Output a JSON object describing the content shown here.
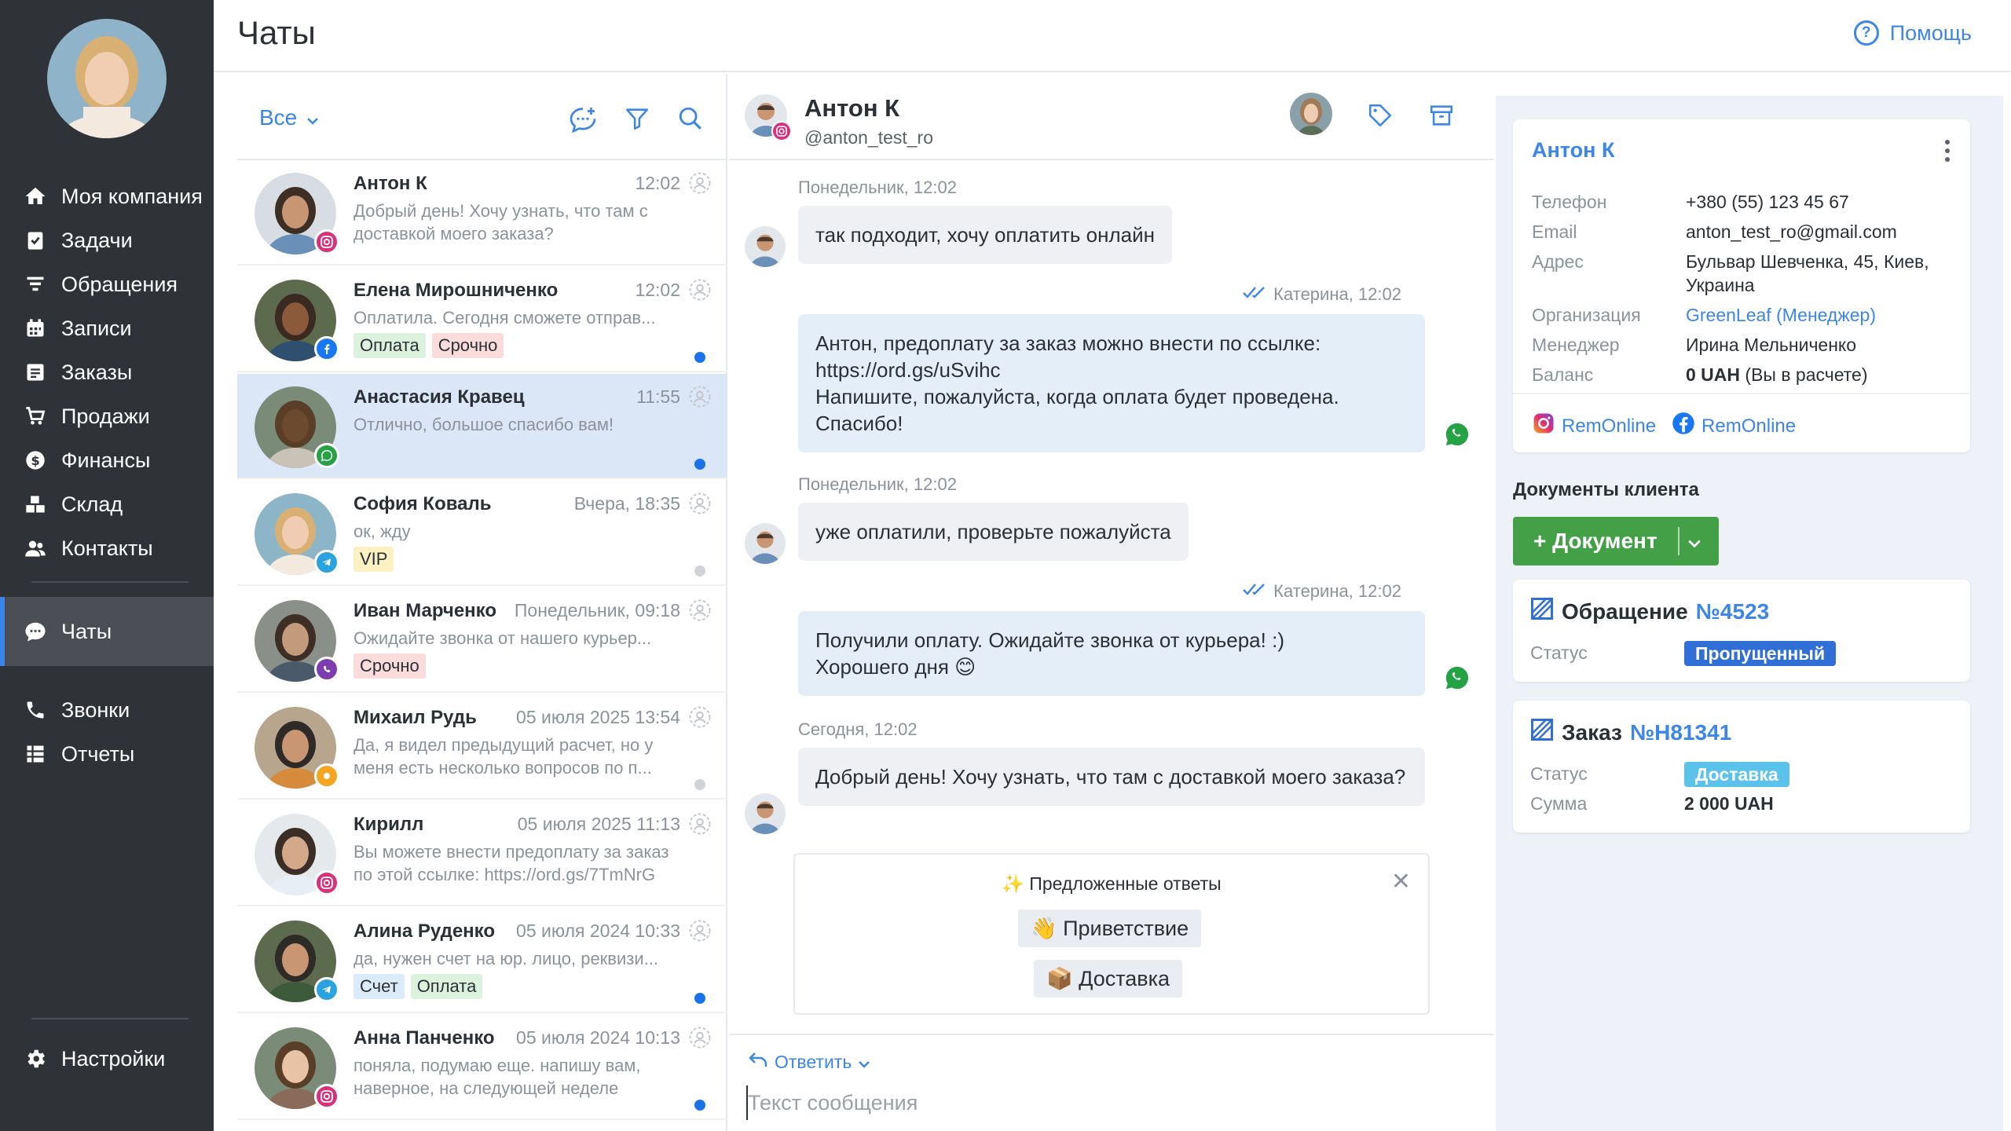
{
  "sidebar": {
    "items": [
      {
        "label": "Моя компания",
        "icon": "home-icon"
      },
      {
        "label": "Задачи",
        "icon": "clipboard-check-icon"
      },
      {
        "label": "Обращения",
        "icon": "funnel-icon"
      },
      {
        "label": "Записи",
        "icon": "calendar-icon"
      },
      {
        "label": "Заказы",
        "icon": "order-icon"
      },
      {
        "label": "Продажи",
        "icon": "cart-icon"
      },
      {
        "label": "Финансы",
        "icon": "dollar-circle-icon"
      },
      {
        "label": "Склад",
        "icon": "boxes-icon"
      },
      {
        "label": "Контакты",
        "icon": "users-icon"
      },
      {
        "label": "Чаты",
        "icon": "chat-icon",
        "active": true
      },
      {
        "label": "Звонки",
        "icon": "phone-icon"
      },
      {
        "label": "Отчеты",
        "icon": "table-icon"
      },
      {
        "label": "Настройки",
        "icon": "gear-icon"
      }
    ]
  },
  "header": {
    "title": "Чаты",
    "help_label": "Помощь"
  },
  "chat_list": {
    "filter_label": "Все",
    "chats": [
      {
        "name": "Антон К",
        "time": "12:02",
        "text": "Добрый день! Хочу узнать, что там с доставкой моего заказа?",
        "network": "instagram",
        "tags": [],
        "dot": ""
      },
      {
        "name": "Елена Мирошниченко",
        "time": "12:02",
        "text": "Оплатила. Сегодня сможете отправ...",
        "network": "facebook",
        "tags": [
          {
            "label": "Оплата",
            "color": "green"
          },
          {
            "label": "Срочно",
            "color": "red"
          }
        ],
        "dot": "blue"
      },
      {
        "name": "Анастасия Кравец",
        "time": "11:55",
        "text": "Отлично, большое спасибо вам!",
        "network": "whatsapp",
        "tags": [],
        "dot": "blue",
        "selected": true
      },
      {
        "name": "София Коваль",
        "time": "Вчера, 18:35",
        "text": "ок, жду",
        "network": "telegram",
        "tags": [
          {
            "label": "VIP",
            "color": "yellow"
          }
        ],
        "dot": "grey"
      },
      {
        "name": "Иван Марченко",
        "time": "Понедельник, 09:18",
        "text": "Ожидайте звонка от нашего курьер...",
        "network": "viber",
        "tags": [
          {
            "label": "Срочно",
            "color": "red"
          }
        ],
        "dot": ""
      },
      {
        "name": "Михаил Рудь",
        "time": "05 июля 2025 13:54",
        "text": "Да, я видел предыдущий расчет, но у меня есть несколько вопросов по п...",
        "network": "other",
        "tags": [],
        "dot": "grey"
      },
      {
        "name": "Кирилл",
        "time": "05 июля 2025 11:13",
        "text": "Вы можете внести предоплату за заказ по этой ссылке: https://ord.gs/7TmNrG",
        "network": "instagram",
        "tags": [],
        "dot": ""
      },
      {
        "name": "Алина Руденко",
        "time": "05 июля 2024 10:33",
        "text": "да, нужен счет на юр. лицо, реквизи...",
        "network": "telegram",
        "tags": [
          {
            "label": "Счет",
            "color": "blue"
          },
          {
            "label": "Оплата",
            "color": "green"
          }
        ],
        "dot": "blue"
      },
      {
        "name": "Анна Панченко",
        "time": "05 июля 2024 10:13",
        "text": "поняла, подумаю еще. напишу вам, наверное, на следующей неделе",
        "network": "instagram",
        "tags": [],
        "dot": "blue"
      }
    ]
  },
  "conversation": {
    "name": "Антон К",
    "username": "@anton_test_ro",
    "messages": [
      {
        "meta": "Понедельник, 12:02",
        "text": "так подходит, хочу оплатить онлайн",
        "dir": "in"
      },
      {
        "meta": "Катерина, 12:02",
        "text": "Антон, предоплату за заказ можно внести по ссылке:\nhttps://ord.gs/uSvihc\nНапишите, пожалуйста, когда оплата будет проведена. Спасибо!",
        "dir": "out"
      },
      {
        "meta": "Понедельник, 12:02",
        "text": "уже оплатили, проверьте пожалуйста",
        "dir": "in"
      },
      {
        "meta": "Катерина, 12:02",
        "text": "Получили оплату. Ожидайте звонка от курьера! :)\nХорошего дня 😊",
        "dir": "out"
      },
      {
        "meta": "Сегодня, 12:02",
        "text": "Добрый день! Хочу узнать, что там с доставкой моего заказа?",
        "dir": "in"
      }
    ],
    "suggestions": {
      "title": "✨ Предложенные ответы",
      "items": [
        "👋 Приветствие",
        "📦 Доставка"
      ]
    },
    "reply_label": "Ответить",
    "input_placeholder": "Текст сообщения"
  },
  "contact": {
    "name": "Антон К",
    "fields": [
      {
        "label": "Телефон",
        "value": "+380 (55) 123 45 67"
      },
      {
        "label": "Email",
        "value": "anton_test_ro@gmail.com"
      },
      {
        "label": "Адрес",
        "value": "Бульвар Шевченка, 45, Киев, Украина"
      },
      {
        "label": "Организация",
        "value": "GreenLeaf (Менеджер)",
        "link": true
      },
      {
        "label": "Менеджер",
        "value": "Ирина Мельниченко"
      },
      {
        "label": "Баланс",
        "value_bold": "0 UAH",
        "value_rest": " (Вы в расчете)"
      }
    ],
    "socials": [
      {
        "network": "instagram",
        "label": "RemOnline"
      },
      {
        "network": "facebook",
        "label": "RemOnline"
      }
    ]
  },
  "documents": {
    "title": "Документы клиента",
    "add_label": "+ Документ",
    "cards": [
      {
        "type": "Обращение",
        "number": "№4523",
        "rows": [
          {
            "label": "Статус",
            "badge": "Пропущенный",
            "badge_color": "#2f6fd6"
          }
        ]
      },
      {
        "type": "Заказ",
        "number": "№H81341",
        "rows": [
          {
            "label": "Статус",
            "badge": "Доставка",
            "badge_color": "#5bc3ea"
          },
          {
            "label": "Сумма",
            "value": "2 000 UAH"
          }
        ]
      }
    ]
  },
  "colors": {
    "accent": "#3b86e8",
    "sidebar": "#2f3237",
    "success": "#43a047",
    "selected_row": "#dbe7f6"
  }
}
